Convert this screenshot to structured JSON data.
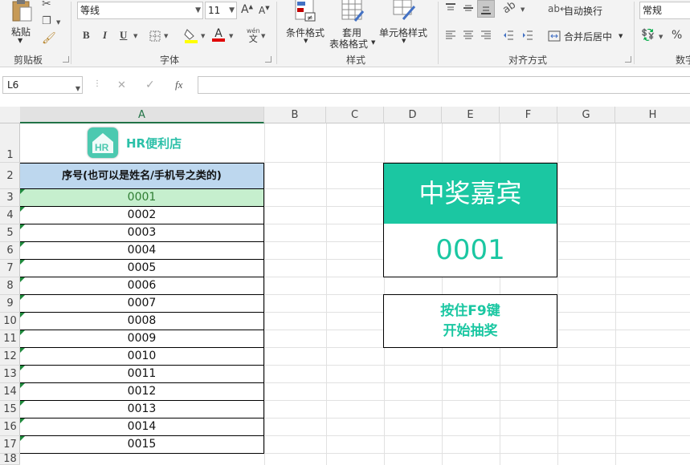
{
  "ribbon": {
    "clipboard": {
      "paste_label": "粘贴",
      "group_label": "剪贴板"
    },
    "font": {
      "font_name": "等线",
      "font_size": "11",
      "bold": "B",
      "italic": "I",
      "underline": "U",
      "phonetic": "wén",
      "phonetic_char": "文",
      "group_label": "字体",
      "grow": "A",
      "shrink": "A",
      "font_color_letter": "A"
    },
    "styles": {
      "conditional_format": "条件格式",
      "table_format_line1": "套用",
      "table_format_line2": "表格格式",
      "cell_styles": "单元格样式",
      "group_label": "样式"
    },
    "alignment": {
      "wrap_text": "自动换行",
      "merge_center": "合并后居中",
      "group_label": "对齐方式"
    },
    "number": {
      "format": "常规",
      "group_label": "数字"
    }
  },
  "formula_bar": {
    "name_box": "L6",
    "cancel": "✕",
    "enter": "✓",
    "fx": "fx",
    "value": ""
  },
  "columns": [
    "A",
    "B",
    "C",
    "D",
    "E",
    "F",
    "G",
    "H"
  ],
  "rows": [
    "1",
    "2",
    "3",
    "4",
    "5",
    "6",
    "7",
    "8",
    "9",
    "10",
    "11",
    "12",
    "13",
    "14",
    "15",
    "16",
    "17",
    "18"
  ],
  "sheet": {
    "logo_text": "HR便利店",
    "list_header": "序号(也可以是姓名/手机号之类的)",
    "entries": [
      "0001",
      "0002",
      "0003",
      "0004",
      "0005",
      "0006",
      "0007",
      "0008",
      "0009",
      "0010",
      "0011",
      "0012",
      "0013",
      "0014",
      "0015"
    ],
    "prize_title": "中奖嘉宾",
    "prize_number": "0001",
    "instruction_line1": "按住F9键",
    "instruction_line2": "开始抽奖"
  },
  "colors": {
    "accent": "#1bc7a2",
    "header_blue": "#bdd7ee",
    "highlight_green": "#c6efce",
    "excel_green": "#217346"
  }
}
